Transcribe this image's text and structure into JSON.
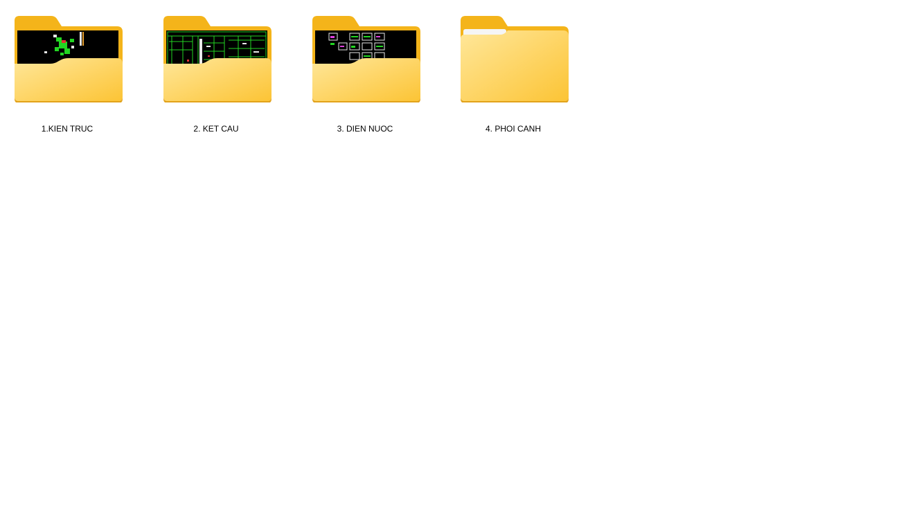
{
  "colors": {
    "folder_back": "#F4B41A",
    "folder_front_light": "#FFE48A",
    "folder_front_dark": "#FCC93C",
    "folder_rim": "#E2A21A",
    "cad_bg": "#000000",
    "cad_green": "#22D622",
    "cad_white": "#E8E8E8",
    "cad_magenta": "#E040E0",
    "cad_red": "#E03030"
  },
  "folders": [
    {
      "name": "1.KIEN TRUC",
      "icon": "folder-with-cad-preview-icon"
    },
    {
      "name": "2. KET CAU",
      "icon": "folder-with-cad-preview-icon"
    },
    {
      "name": "3. DIEN NUOC",
      "icon": "folder-with-cad-preview-icon"
    },
    {
      "name": "4. PHOI CANH",
      "icon": "empty-folder-icon"
    }
  ]
}
